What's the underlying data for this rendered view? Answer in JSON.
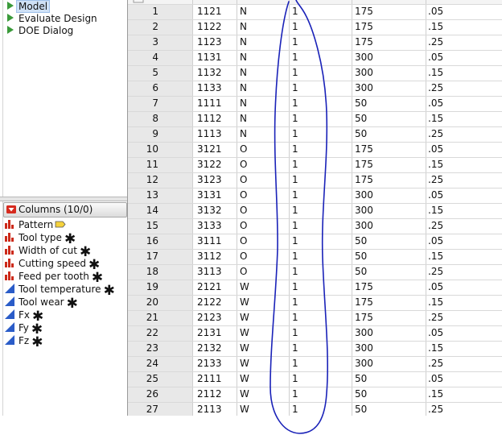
{
  "scripts": [
    {
      "label": "Model",
      "selected": true
    },
    {
      "label": "Evaluate Design",
      "selected": false
    },
    {
      "label": "DOE Dialog",
      "selected": false
    }
  ],
  "columns_header": "Columns (10/0)",
  "columns": [
    {
      "name": "Pattern",
      "icon": "nominal-bars-icon",
      "badge": "label-tag-icon"
    },
    {
      "name": "Tool type",
      "icon": "nominal-bars-icon",
      "badge": "asterisk"
    },
    {
      "name": "Width of cut",
      "icon": "nominal-bars-icon",
      "badge": "asterisk"
    },
    {
      "name": "Cutting speed",
      "icon": "nominal-bars-icon",
      "badge": "asterisk"
    },
    {
      "name": "Feed per tooth",
      "icon": "nominal-bars-icon",
      "badge": "asterisk"
    },
    {
      "name": "Tool temperature",
      "icon": "continuous-ramp-icon",
      "badge": "asterisk"
    },
    {
      "name": "Tool wear",
      "icon": "continuous-ramp-icon",
      "badge": "asterisk"
    },
    {
      "name": "Fx",
      "icon": "continuous-ramp-icon",
      "badge": "asterisk"
    },
    {
      "name": "Fy",
      "icon": "continuous-ramp-icon",
      "badge": "asterisk"
    },
    {
      "name": "Fz",
      "icon": "continuous-ramp-icon",
      "badge": "asterisk"
    }
  ],
  "asterisk": "✱",
  "rows": [
    [
      "1",
      "1121",
      "N",
      "1",
      "175",
      ".05"
    ],
    [
      "2",
      "1122",
      "N",
      "1",
      "175",
      ".15"
    ],
    [
      "3",
      "1123",
      "N",
      "1",
      "175",
      ".25"
    ],
    [
      "4",
      "1131",
      "N",
      "1",
      "300",
      ".05"
    ],
    [
      "5",
      "1132",
      "N",
      "1",
      "300",
      ".15"
    ],
    [
      "6",
      "1133",
      "N",
      "1",
      "300",
      ".25"
    ],
    [
      "7",
      "1111",
      "N",
      "1",
      "50",
      ".05"
    ],
    [
      "8",
      "1112",
      "N",
      "1",
      "50",
      ".15"
    ],
    [
      "9",
      "1113",
      "N",
      "1",
      "50",
      ".25"
    ],
    [
      "10",
      "3121",
      "O",
      "1",
      "175",
      ".05"
    ],
    [
      "11",
      "3122",
      "O",
      "1",
      "175",
      ".15"
    ],
    [
      "12",
      "3123",
      "O",
      "1",
      "175",
      ".25"
    ],
    [
      "13",
      "3131",
      "O",
      "1",
      "300",
      ".05"
    ],
    [
      "14",
      "3132",
      "O",
      "1",
      "300",
      ".15"
    ],
    [
      "15",
      "3133",
      "O",
      "1",
      "300",
      ".25"
    ],
    [
      "16",
      "3111",
      "O",
      "1",
      "50",
      ".05"
    ],
    [
      "17",
      "3112",
      "O",
      "1",
      "50",
      ".15"
    ],
    [
      "18",
      "3113",
      "O",
      "1",
      "50",
      ".25"
    ],
    [
      "19",
      "2121",
      "W",
      "1",
      "175",
      ".05"
    ],
    [
      "20",
      "2122",
      "W",
      "1",
      "175",
      ".15"
    ],
    [
      "21",
      "2123",
      "W",
      "1",
      "175",
      ".25"
    ],
    [
      "22",
      "2131",
      "W",
      "1",
      "300",
      ".05"
    ],
    [
      "23",
      "2132",
      "W",
      "1",
      "300",
      ".15"
    ],
    [
      "24",
      "2133",
      "W",
      "1",
      "300",
      ".25"
    ],
    [
      "25",
      "2111",
      "W",
      "1",
      "50",
      ".05"
    ],
    [
      "26",
      "2112",
      "W",
      "1",
      "50",
      ".15"
    ],
    [
      "27",
      "2113",
      "W",
      "1",
      "50",
      ".25"
    ]
  ],
  "colors": {
    "script_triangle": "#3a9a3a",
    "nominal_icon": "#cc2a1a",
    "continuous_icon": "#2a5cc8",
    "annotation_ink": "#1a22b8",
    "row_number_bg": "#e8e8e8",
    "selection_bg": "#cfe1f6"
  }
}
